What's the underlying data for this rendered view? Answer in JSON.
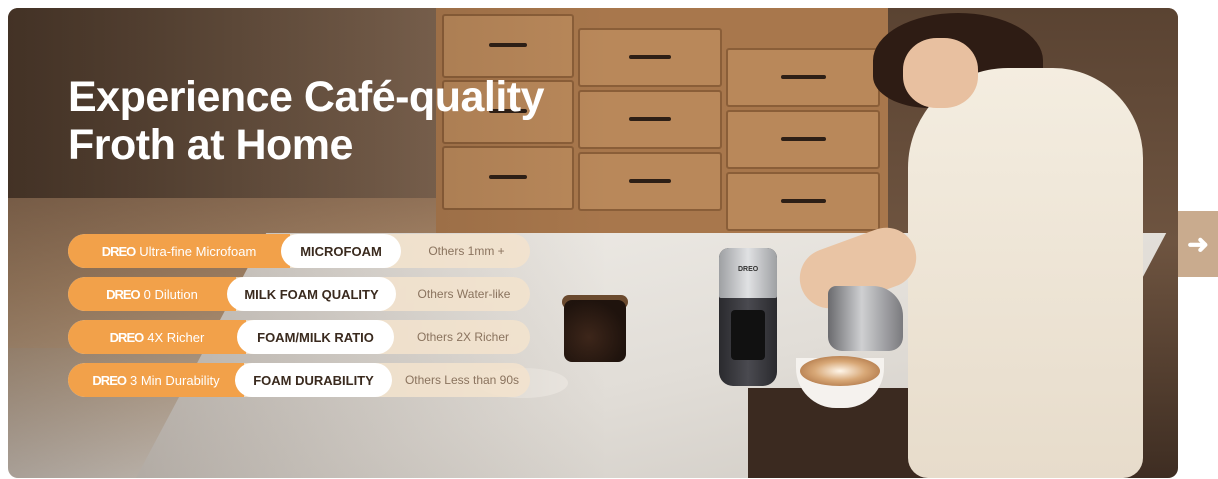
{
  "banner": {
    "headline_line1": "Experience Café-quality",
    "headline_line2": "Froth at Home",
    "product_logo": "DREO"
  },
  "comparisons": [
    {
      "brand": "DREO",
      "claim": "Ultra-fine Microfoam",
      "label": "MICROFOAM",
      "others": "Others 1mm +"
    },
    {
      "brand": "DREO",
      "claim": "0 Dilution",
      "label": "MILK FOAM QUALITY",
      "others": "Others Water-like"
    },
    {
      "brand": "DREO",
      "claim": "4X Richer",
      "label": "FOAM/MILK RATIO",
      "others": "Others 2X Richer"
    },
    {
      "brand": "DREO",
      "claim": "3 Min Durability",
      "label": "FOAM DURABILITY",
      "others": "Others Less than 90s"
    }
  ],
  "navigation": {
    "next_icon": "arrow-right-icon",
    "next_glyph": "➜"
  },
  "colors": {
    "accent_orange": "#f2a14a",
    "next_button": "#c9ab8e"
  }
}
